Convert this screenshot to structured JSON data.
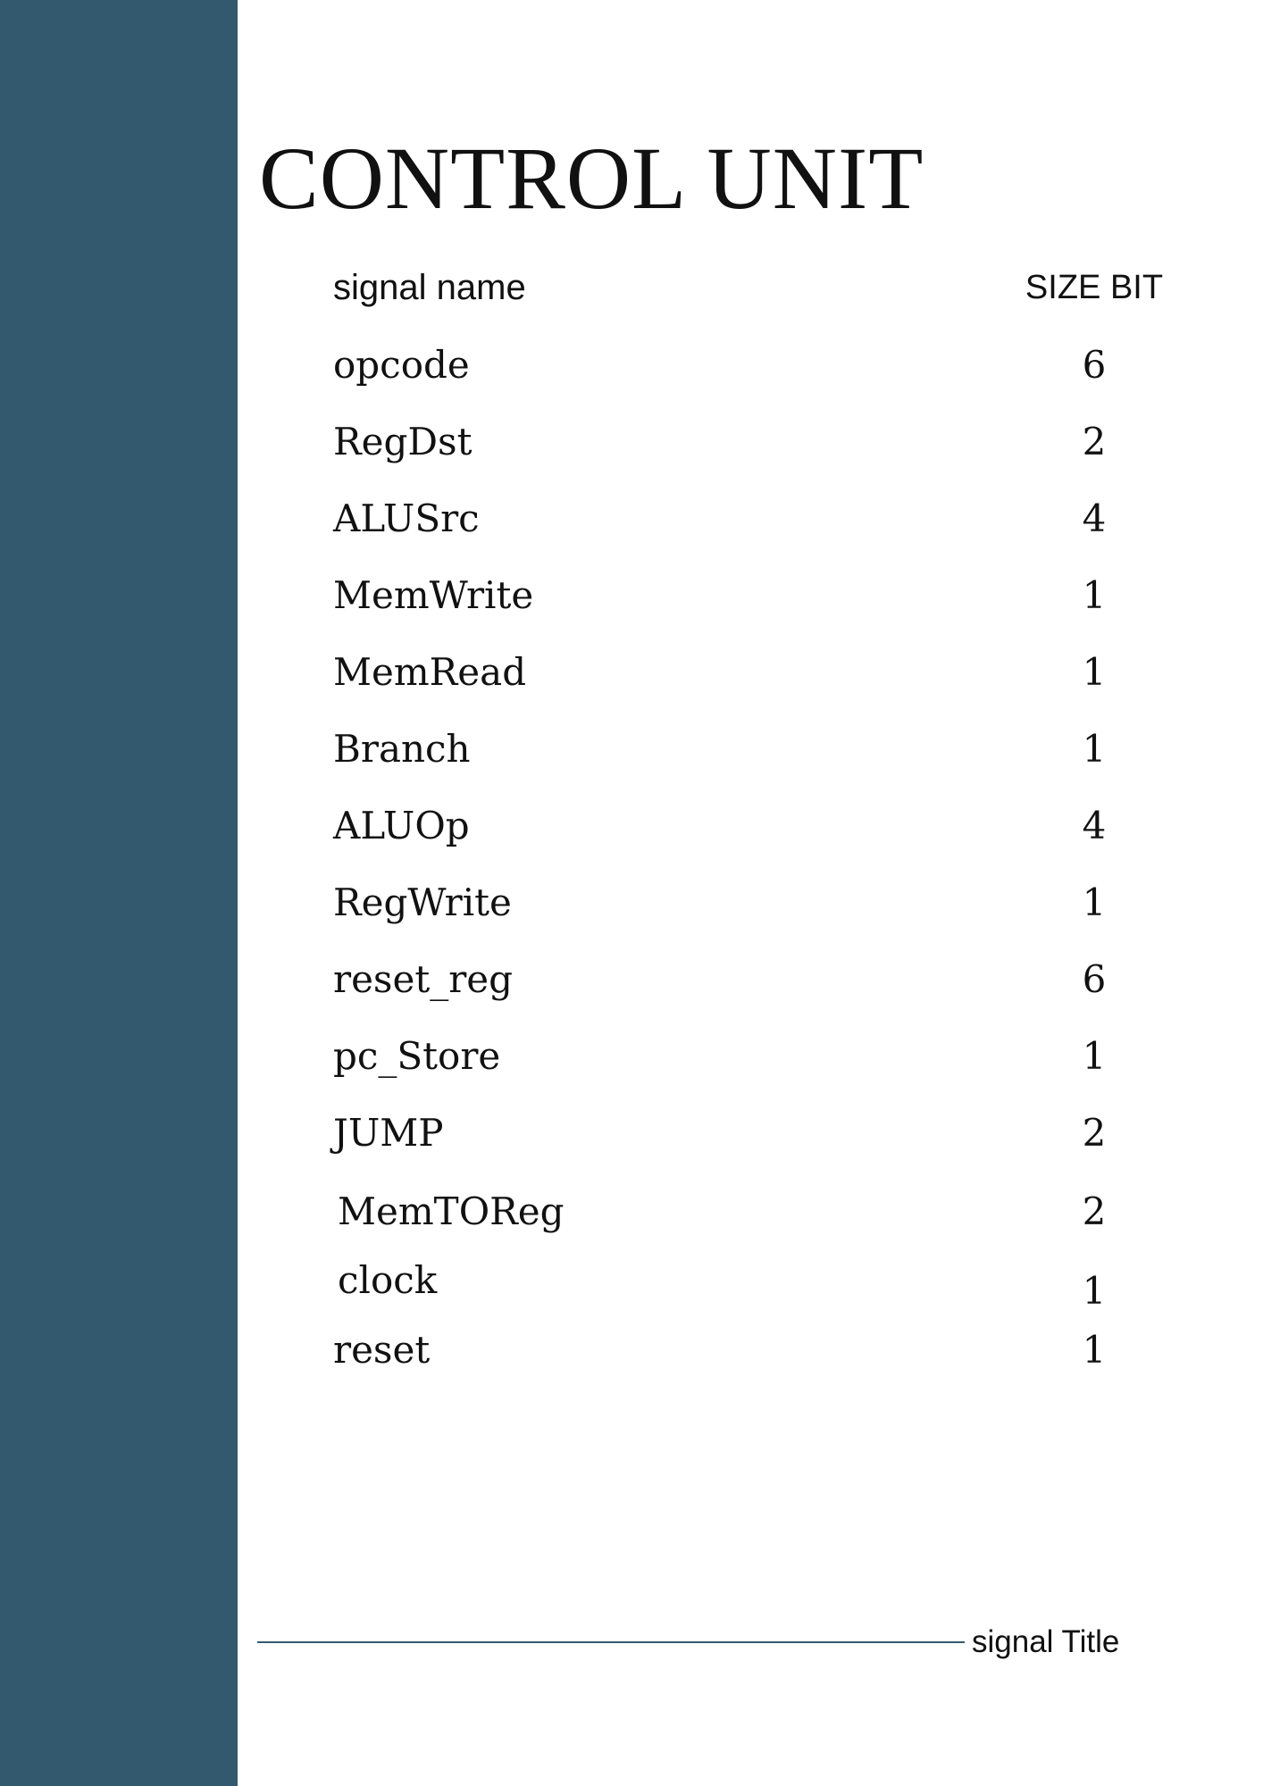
{
  "title": "CONTROL UNIT",
  "table": {
    "header": {
      "name": "signal name",
      "size": "SIZE BIT"
    },
    "rows": [
      {
        "name": "opcode",
        "size": "6"
      },
      {
        "name": "RegDst",
        "size": "2"
      },
      {
        "name": "ALUSrc",
        "size": "4"
      },
      {
        "name": "MemWrite",
        "size": "1"
      },
      {
        "name": "MemRead",
        "size": "1"
      },
      {
        "name": "Branch",
        "size": "1"
      },
      {
        "name": "ALUOp",
        "size": "4"
      },
      {
        "name": "RegWrite",
        "size": "1"
      },
      {
        "name": "reset_reg",
        "size": "6"
      },
      {
        "name": "pc_Store",
        "size": "1"
      },
      {
        "name": "JUMP",
        "size": "2"
      },
      {
        "name": "MemTOReg",
        "size": "2"
      },
      {
        "name": "clock",
        "size": "1"
      },
      {
        "name": "reset",
        "size": "1"
      }
    ]
  },
  "footer": {
    "label": "signal Title"
  },
  "colors": {
    "sidebar": "#33596f",
    "text": "#111111"
  }
}
